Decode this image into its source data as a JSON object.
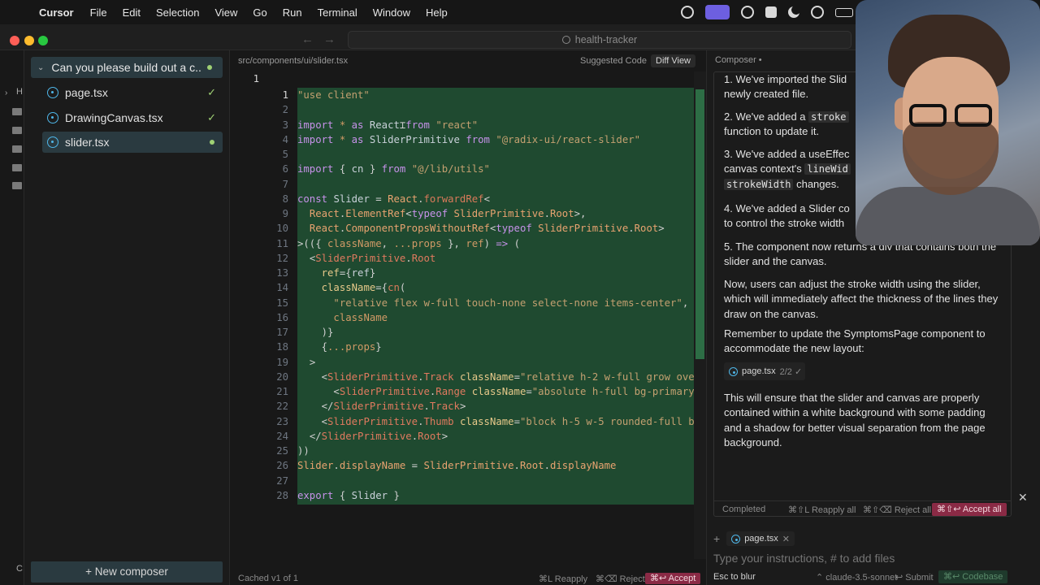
{
  "menubar": {
    "app": "Cursor",
    "items": [
      "File",
      "Edit",
      "Selection",
      "View",
      "Go",
      "Run",
      "Terminal",
      "Window",
      "Help"
    ]
  },
  "titlebar": {
    "search": "health-tracker"
  },
  "sidebar": {
    "conversation_title": "Can you please build out a c...",
    "files": [
      {
        "name": "page.tsx",
        "status": "✓"
      },
      {
        "name": "DrawingCanvas.tsx",
        "status": "✓"
      },
      {
        "name": "slider.tsx",
        "status": "dot"
      }
    ],
    "new_composer": "+ New composer",
    "strip_labels": [
      "H",
      "C"
    ]
  },
  "editor": {
    "breadcrumb": "src/components/ui/slider.tsx",
    "suggested_code": "Suggested Code",
    "diff_view": "Diff View",
    "top_line_number": "1",
    "lines": [
      "1",
      "2",
      "3",
      "4",
      "5",
      "6",
      "7",
      "8",
      "9",
      "10",
      "11",
      "12",
      "13",
      "14",
      "15",
      "16",
      "17",
      "18",
      "19",
      "20",
      "21",
      "22",
      "23",
      "24",
      "25",
      "26",
      "27",
      "28"
    ],
    "footer": {
      "cached": "Cached v1 of 1",
      "reapply": "⌘L Reapply",
      "reject": "⌘⌫ Reject",
      "accept": "⌘↩ Accept"
    }
  },
  "composer": {
    "tab": "Composer •",
    "messages": {
      "m1": "1. We've imported the Slid",
      "m1b": "newly created file.",
      "m2a": "2. We've added a ",
      "m2code": "stroke",
      "m2b": "function to update it.",
      "m3": "3. We've added a useEffec",
      "m3b": "canvas context's ",
      "m3code": "lineWid",
      "m3code2": "strokeWidth",
      "m3c": " changes.",
      "m4": "4. We've added a Slider co",
      "m4b": "to control the stroke width",
      "m5": "5. The component now returns a div that contains both the slider and the canvas.",
      "p1": "Now, users can adjust the stroke width using the slider, which will immediately affect the thickness of the lines they draw on the canvas.",
      "p2": "Remember to update the SymptomsPage component to accommodate the new layout:",
      "p3": "This will ensure that the slider and canvas are properly contained within a white background with some padding and a shadow for better visual separation from the page background."
    },
    "chip": {
      "name": "page.tsx",
      "count": "2/2 ✓"
    },
    "status": {
      "completed": "Completed",
      "reapply_all": "⌘⇧L Reapply all",
      "reject_all": "⌘⇧⌫ Reject all",
      "accept_all": "⌘⇧↩ Accept all"
    },
    "attached_file": "page.tsx",
    "input_placeholder": "Type your instructions, # to add files",
    "bottom": {
      "esc": "Esc to blur",
      "model": "⌃ claude-3.5-sonnet",
      "submit": "↩ Submit",
      "codebase": "⌘↩ Codebase"
    }
  }
}
